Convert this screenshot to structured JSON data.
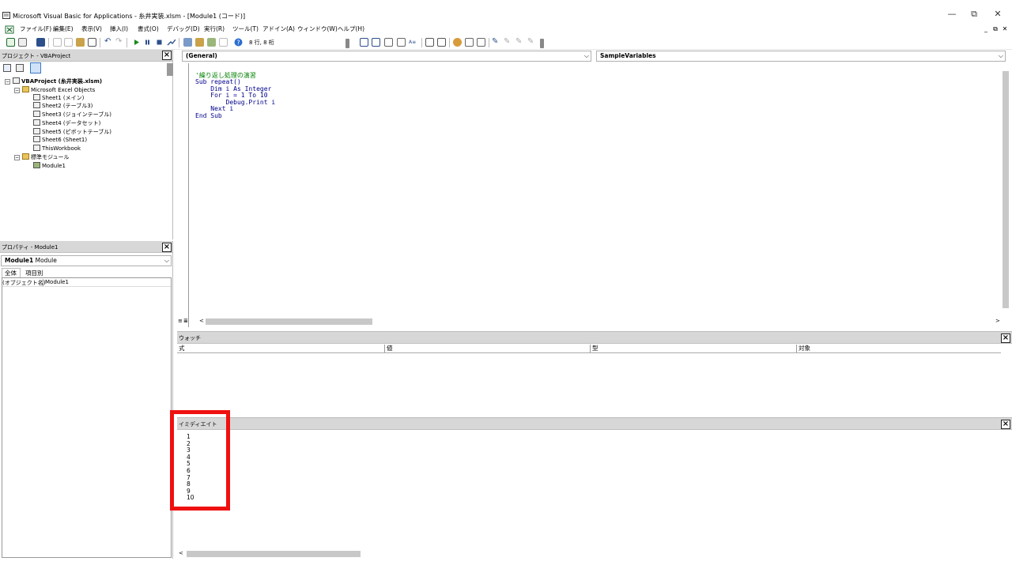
{
  "window": {
    "title": "Microsoft Visual Basic for Applications - 糸井実装.xlsm - [Module1 (コード)]",
    "controls": {
      "minimize": "—",
      "restore": "⧉",
      "close": "✕"
    },
    "mdi_controls": {
      "minimize": "_",
      "restore": "⧉",
      "close": "✕"
    }
  },
  "menu": [
    "ファイル(F)",
    "編集(E)",
    "表示(V)",
    "挿入(I)",
    "書式(O)",
    "デバッグ(D)",
    "実行(R)",
    "ツール(T)",
    "アドイン(A)",
    "ウィンドウ(W)",
    "ヘルプ(H)"
  ],
  "toolbar": {
    "position": "8 行, 8 桁"
  },
  "project": {
    "title": "プロジェクト - VBAProject",
    "root": "VBAProject (糸井実装.xlsm)",
    "folder_objects": "Microsoft Excel Objects",
    "sheets": [
      "Sheet1 (メイン)",
      "Sheet2 (テーブル3)",
      "Sheet3 (ジョインテーブル)",
      "Sheet4 (データセット)",
      "Sheet5 (ピボットテーブル)",
      "Sheet6 (Sheet1)",
      "ThisWorkbook"
    ],
    "folder_modules": "標準モジュール",
    "module": "Module1"
  },
  "properties": {
    "title": "プロパティ - Module1",
    "selector_name": "Module1",
    "selector_type": "Module",
    "tab_all": "全体",
    "tab_category": "項目別",
    "prop_name": "(オブジェクト名)",
    "prop_value": "Module1"
  },
  "code": {
    "object_combo": "(General)",
    "proc_combo": "SampleVariables",
    "lines": [
      "'繰り返し処理の演習",
      "Sub repeat()",
      "    Dim i As Integer",
      "    For i = 1 To 10",
      "        Debug.Print i",
      "    Next i",
      "End Sub"
    ]
  },
  "watch": {
    "title": "ウォッチ",
    "columns": [
      "式",
      "値",
      "型",
      "対象"
    ]
  },
  "immediate": {
    "title": "イミディエイト",
    "output": [
      "1",
      "2",
      "3",
      "4",
      "5",
      "6",
      "7",
      "8",
      "9",
      "10"
    ]
  },
  "colors": {
    "highlight": "#ef1010",
    "comment": "#008000",
    "keyword": "#00008b",
    "pane_header": "#d7d7d7"
  }
}
